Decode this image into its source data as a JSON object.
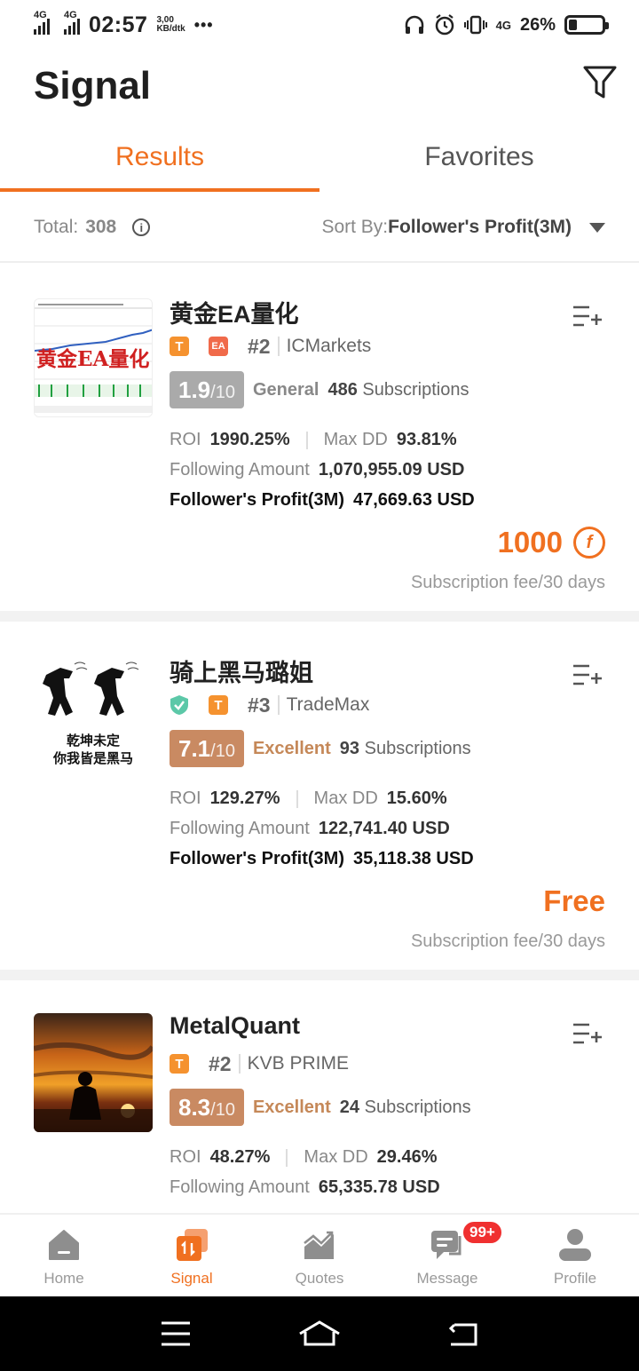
{
  "status_bar": {
    "network1": "4G",
    "network2": "4G",
    "time": "02:57",
    "speed_value": "3,00",
    "speed_unit": "KB/dtk",
    "more": "•••",
    "network3": "4G",
    "battery_pct": "26%",
    "battery_level": 0.26
  },
  "header": {
    "title": "Signal"
  },
  "tabs": [
    {
      "label": "Results",
      "active": true
    },
    {
      "label": "Favorites",
      "active": false
    }
  ],
  "toolbar": {
    "total_label": "Total:",
    "total_value": "308",
    "sort_label": "Sort By:",
    "sort_value": "Follower's Profit(3M)"
  },
  "signals": [
    {
      "name": "黄金EA量化",
      "avatar_text": "黄金EA量化",
      "tags": [
        "T",
        "EA"
      ],
      "rank": "#2",
      "broker": "ICMarkets",
      "score": "1.9",
      "score_denominator": "/10",
      "level": "General",
      "subscriptions_count": "486",
      "subscriptions_label": "Subscriptions",
      "roi_label": "ROI",
      "roi": "1990.25%",
      "maxdd_label": "Max DD",
      "maxdd": "93.81%",
      "following_label": "Following Amount",
      "following_amount": "1,070,955.09 USD",
      "profit_label": "Follower's Profit(3M)",
      "profit": "47,669.63 USD",
      "price": "1000",
      "fee_note": "Subscription fee/30 days"
    },
    {
      "name": "骑上黑马璐姐",
      "avatar_line1": "乾坤未定",
      "avatar_line2": "你我皆是黑马",
      "tags": [
        "T"
      ],
      "rank": "#3",
      "broker": "TradeMax",
      "score": "7.1",
      "score_denominator": "/10",
      "level": "Excellent",
      "subscriptions_count": "93",
      "subscriptions_label": "Subscriptions",
      "roi_label": "ROI",
      "roi": "129.27%",
      "maxdd_label": "Max DD",
      "maxdd": "15.60%",
      "following_label": "Following Amount",
      "following_amount": "122,741.40 USD",
      "profit_label": "Follower's Profit(3M)",
      "profit": "35,118.38 USD",
      "price": "Free",
      "fee_note": "Subscription fee/30 days"
    },
    {
      "name": "MetalQuant",
      "tags": [
        "T"
      ],
      "rank": "#2",
      "broker": "KVB PRIME",
      "score": "8.3",
      "score_denominator": "/10",
      "level": "Excellent",
      "subscriptions_count": "24",
      "subscriptions_label": "Subscriptions",
      "roi_label": "ROI",
      "roi": "48.27%",
      "maxdd_label": "Max DD",
      "maxdd": "29.46%",
      "following_label": "Following Amount",
      "following_amount": "65,335.78 USD"
    }
  ],
  "bottom_nav": [
    {
      "label": "Home",
      "icon": "home-icon",
      "active": false
    },
    {
      "label": "Signal",
      "icon": "signal-icon",
      "active": true
    },
    {
      "label": "Quotes",
      "icon": "quotes-icon",
      "active": false
    },
    {
      "label": "Message",
      "icon": "message-icon",
      "active": false,
      "badge": "99+"
    },
    {
      "label": "Profile",
      "icon": "profile-icon",
      "active": false
    }
  ],
  "colors": {
    "accent": "#f07020",
    "excellent": "#c98a62",
    "general": "#aaaaaa"
  }
}
